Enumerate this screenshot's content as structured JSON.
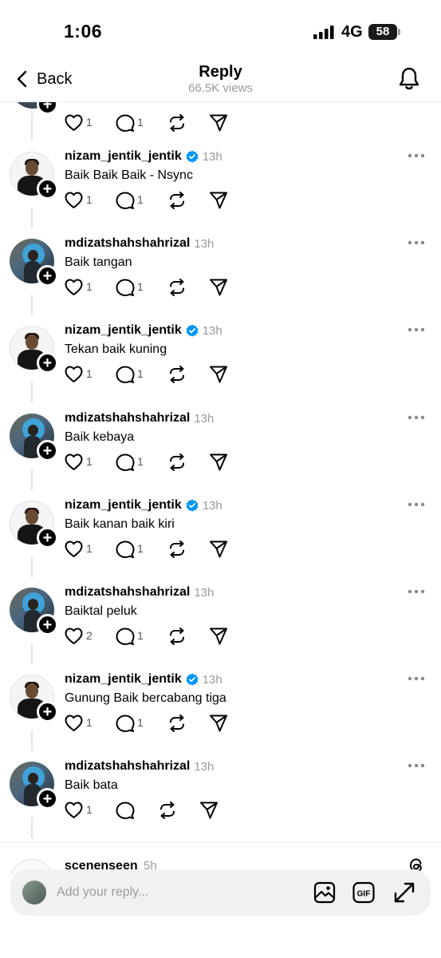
{
  "status_bar": {
    "time": "1:06",
    "network": "4G",
    "battery": "58"
  },
  "nav": {
    "back_label": "Back",
    "title": "Reply",
    "subtitle": "66.5K views"
  },
  "posts": [
    {
      "username": "nizam_jentik_jentik",
      "verified": true,
      "time": "13h",
      "text": "Baik Baik Baik - Nsync",
      "likes": "1",
      "replies": "1",
      "avatar": "nizam"
    },
    {
      "username": "mdizatshahshahrizal",
      "verified": false,
      "time": "13h",
      "text": "Baik tangan",
      "likes": "1",
      "replies": "1",
      "avatar": "mdi"
    },
    {
      "username": "nizam_jentik_jentik",
      "verified": true,
      "time": "13h",
      "text": "Tekan baik kuning",
      "likes": "1",
      "replies": "1",
      "avatar": "nizam"
    },
    {
      "username": "mdizatshahshahrizal",
      "verified": false,
      "time": "13h",
      "text": "Baik kebaya",
      "likes": "1",
      "replies": "1",
      "avatar": "mdi"
    },
    {
      "username": "nizam_jentik_jentik",
      "verified": true,
      "time": "13h",
      "text": "Baik kanan baik kiri",
      "likes": "1",
      "replies": "1",
      "avatar": "nizam"
    },
    {
      "username": "mdizatshahshahrizal",
      "verified": false,
      "time": "13h",
      "text": "Baiktal peluk",
      "likes": "2",
      "replies": "1",
      "avatar": "mdi"
    },
    {
      "username": "nizam_jentik_jentik",
      "verified": true,
      "time": "13h",
      "text": "Gunung Baik bercabang tiga",
      "likes": "1",
      "replies": "1",
      "avatar": "nizam"
    },
    {
      "username": "mdizatshahshahrizal",
      "verified": false,
      "time": "13h",
      "text": "Baik bata",
      "likes": "1",
      "replies": "",
      "avatar": "mdi"
    }
  ],
  "top_stub": {
    "likes": "1",
    "replies": "1"
  },
  "peek": {
    "username": "scenenseen",
    "time": "5h"
  },
  "reply_bar": {
    "placeholder": "Add your reply..."
  },
  "colors": {
    "verified": "#0095f6",
    "muted": "#9a9a9a",
    "line": "#e3e3e3"
  },
  "icons": [
    "chevron-left-icon",
    "bell-icon",
    "heart-icon",
    "reply-icon",
    "repost-icon",
    "share-icon",
    "more-icon",
    "verified-icon",
    "threads-icon",
    "image-icon",
    "gif-icon",
    "expand-icon"
  ]
}
